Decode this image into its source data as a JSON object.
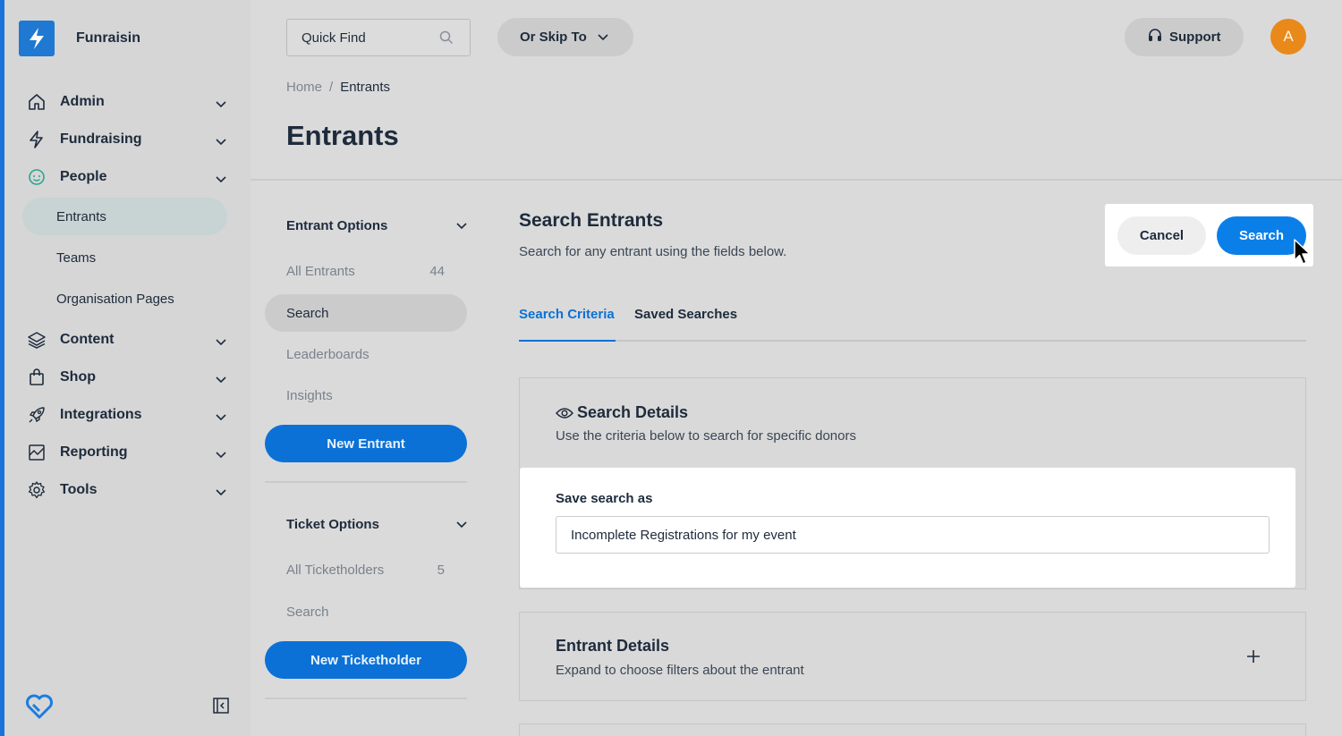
{
  "brand": {
    "name": "Funraisin"
  },
  "colors": {
    "primary": "#0b71d6",
    "avatar": "#e8891a",
    "sidebar_accent": "#1a73d9"
  },
  "sidebar": {
    "nav": [
      {
        "label": "Admin",
        "icon": "home-icon"
      },
      {
        "label": "Fundraising",
        "icon": "lightning-icon"
      },
      {
        "label": "People",
        "icon": "smiley-icon"
      },
      {
        "label": "Content",
        "icon": "layers-icon"
      },
      {
        "label": "Shop",
        "icon": "shopping-bag-icon"
      },
      {
        "label": "Integrations",
        "icon": "rocket-icon"
      },
      {
        "label": "Reporting",
        "icon": "chart-icon"
      },
      {
        "label": "Tools",
        "icon": "gear-icon"
      }
    ],
    "people_sub": [
      "Entrants",
      "Teams",
      "Organisation Pages"
    ]
  },
  "topbar": {
    "quick_find_placeholder": "Quick Find",
    "skip_to": "Or Skip To",
    "support": "Support",
    "avatar_initial": "A"
  },
  "breadcrumb": {
    "home": "Home",
    "sep": "/",
    "current": "Entrants"
  },
  "page_title": "Entrants",
  "entrant_options": {
    "heading": "Entrant Options",
    "items": [
      {
        "label": "All Entrants",
        "count": "44"
      },
      {
        "label": "Search",
        "count": ""
      },
      {
        "label": "Leaderboards",
        "count": ""
      },
      {
        "label": "Insights",
        "count": ""
      }
    ],
    "button": "New Entrant"
  },
  "ticket_options": {
    "heading": "Ticket Options",
    "items": [
      {
        "label": "All Ticketholders",
        "count": "5"
      },
      {
        "label": "Search",
        "count": ""
      }
    ],
    "button": "New Ticketholder"
  },
  "search": {
    "title": "Search Entrants",
    "subtitle": "Search for any entrant using the fields below.",
    "cancel": "Cancel",
    "submit": "Search"
  },
  "tabs": [
    "Search Criteria",
    "Saved Searches"
  ],
  "search_details": {
    "title": "Search Details",
    "subtitle": "Use the criteria below to search for specific donors",
    "save_label": "Save search as",
    "save_value": "Incomplete Registrations for my event"
  },
  "entrant_details": {
    "title": "Entrant Details",
    "subtitle": "Expand to choose filters about the entrant"
  }
}
